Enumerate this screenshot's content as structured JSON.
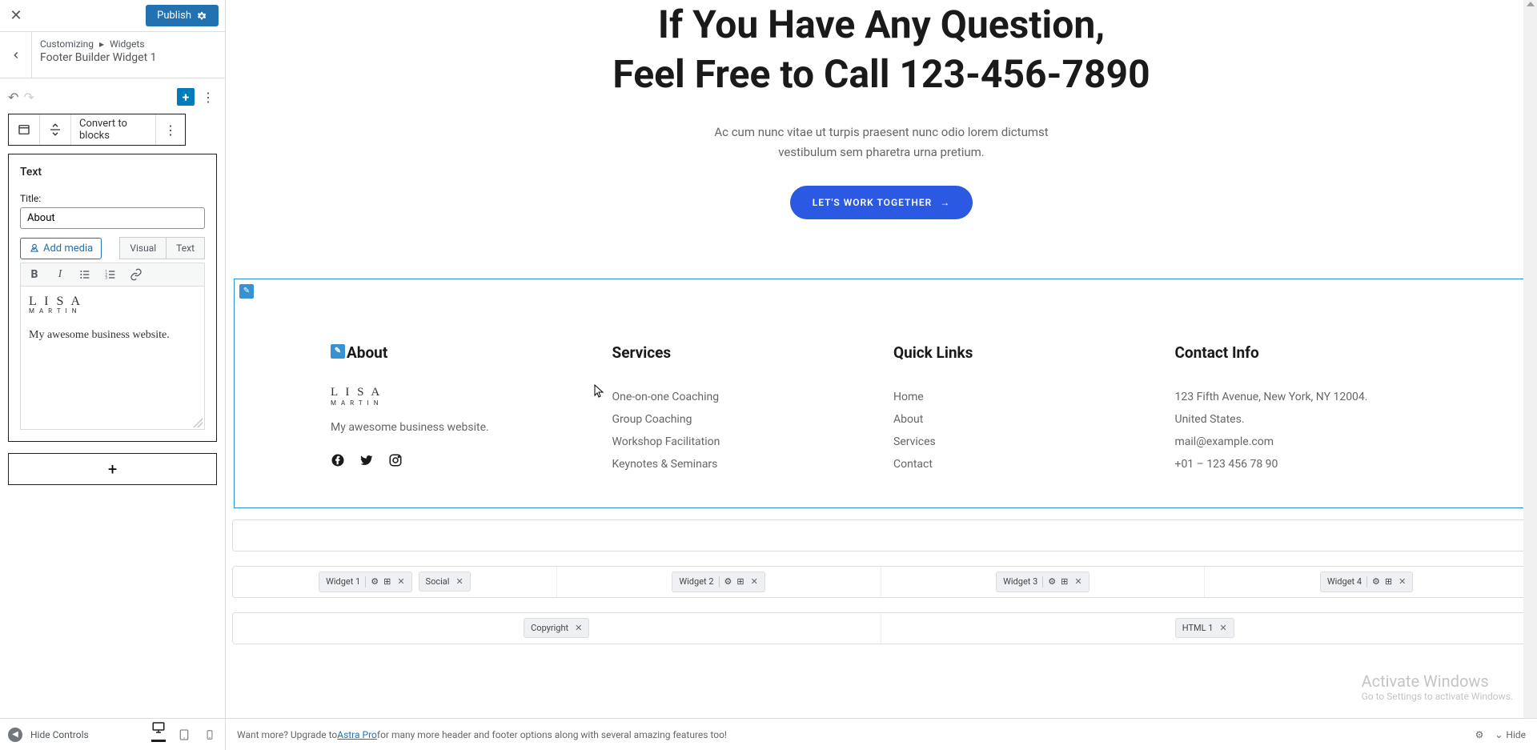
{
  "topbar": {
    "publish_label": "Publish"
  },
  "breadcrumb": {
    "root": "Customizing",
    "section": "Widgets",
    "title": "Footer Builder Widget 1"
  },
  "block_toolbar": {
    "convert_label": "Convert to blocks"
  },
  "widget": {
    "type_label": "Text",
    "title_field_label": "Title:",
    "title_value": "About",
    "add_media_label": "Add media",
    "tab_visual": "Visual",
    "tab_text": "Text",
    "content_logo_top": "L I S A",
    "content_logo_sub": "M A R T I N",
    "content_body": "My awesome business website."
  },
  "hide_controls_label": "Hide Controls",
  "hero": {
    "line1": "If You Have Any Question,",
    "line2": "Feel Free to Call 123-456-7890",
    "sub1": "Ac cum nunc vitae ut turpis praesent nunc odio lorem dictumst",
    "sub2": "vestibulum sem pharetra urna pretium.",
    "cta": "LET'S WORK TOGETHER"
  },
  "footer": {
    "col1": {
      "title": "About",
      "logo_top": "L I S A",
      "logo_sub": "M A R T I N",
      "desc": "My awesome business website."
    },
    "col2": {
      "title": "Services",
      "items": [
        "One-on-one Coaching",
        "Group Coaching",
        "Workshop Facilitation",
        "Keynotes & Seminars"
      ]
    },
    "col3": {
      "title": "Quick Links",
      "items": [
        "Home",
        "About",
        "Services",
        "Contact"
      ]
    },
    "col4": {
      "title": "Contact Info",
      "items": [
        "123 Fifth Avenue, New York, NY 12004.",
        "United States.",
        "mail@example.com",
        "+01 – 123 456 78 90"
      ]
    }
  },
  "builder": {
    "row_middle": {
      "col0": [
        {
          "label": "Widget 1",
          "controls": true
        },
        {
          "label": "Social",
          "controls": false
        }
      ],
      "col1": [
        {
          "label": "Widget 2",
          "controls": true
        }
      ],
      "col2": [
        {
          "label": "Widget 3",
          "controls": true
        }
      ],
      "col3": [
        {
          "label": "Widget 4",
          "controls": true
        }
      ]
    },
    "row_bottom": {
      "col0": [
        {
          "label": "Copyright",
          "controls": false
        }
      ],
      "col1": [
        {
          "label": "HTML 1",
          "controls": false
        }
      ]
    }
  },
  "bottom_bar": {
    "prefix": "Want more? Upgrade to ",
    "link": "Astra Pro",
    "suffix": " for many more header and footer options along with several amazing features too!",
    "hide_label": "Hide"
  },
  "watermark": {
    "line1": "Activate Windows",
    "line2": "Go to Settings to activate Windows."
  }
}
